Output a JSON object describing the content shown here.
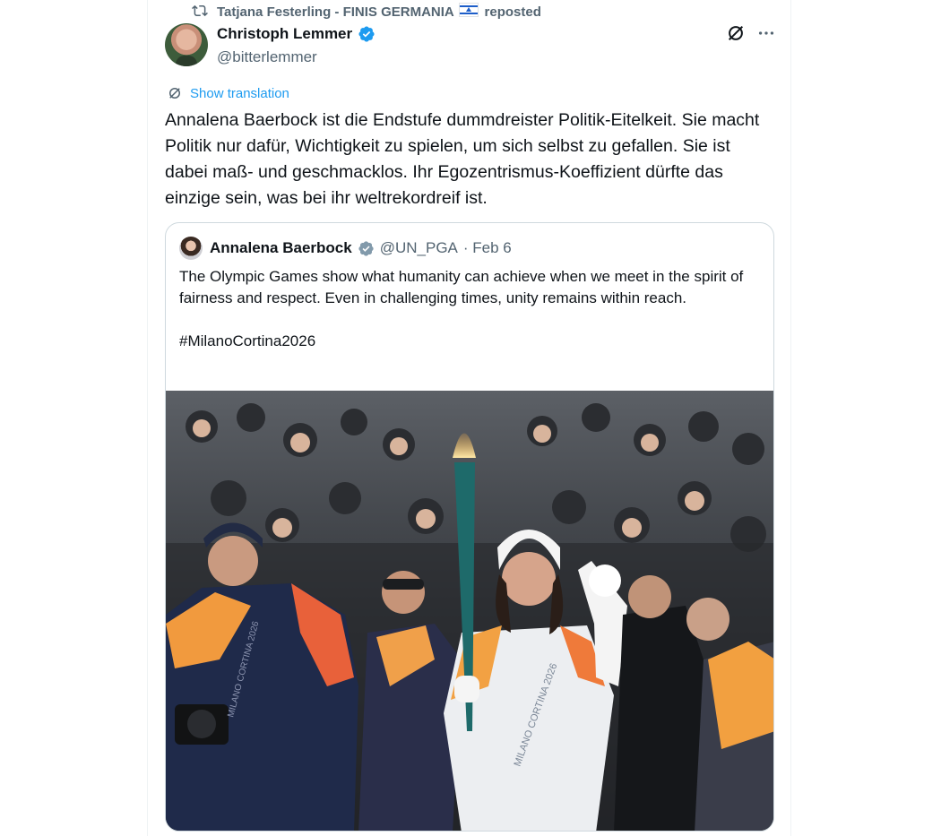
{
  "repost": {
    "user": "Tatjana Festerling - FINIS GERMANIA",
    "suffix": "reposted"
  },
  "author": {
    "name": "Christoph Lemmer",
    "handle": "@bitterlemmer"
  },
  "show_translation": "Show translation",
  "tweet_text": "Annalena Baerbock ist die Endstufe dummdreister Politik-Eitelkeit. Sie macht Politik nur dafür, Wichtigkeit zu spielen, um sich selbst zu gefallen. Sie ist dabei maß- und geschmacklos. Ihr Egozentrismus-Koeffizient dürfte das einzige sein, was bei ihr weltrekordreif ist.",
  "quote": {
    "name": "Annalena Baerbock",
    "handle": "@UN_PGA",
    "date": "· Feb 6",
    "text": "The Olympic Games show what humanity can achieve when we meet in the spirit of fairness and respect. Even in challenging times, unity remains within reach.\n\n#MilanoCortina2026",
    "photo_text": {
      "jacket": "MILANO CORTINA 2026",
      "jacket2": "MILANO CORTINA 2026"
    }
  },
  "colors": {
    "accent": "#1d9bf0",
    "text": "#0f1419",
    "muted": "#536471",
    "border": "#cfd9de"
  },
  "icons": [
    "repost-icon",
    "verified-badge-icon",
    "grok-icon",
    "more-icon",
    "translate-icon"
  ]
}
